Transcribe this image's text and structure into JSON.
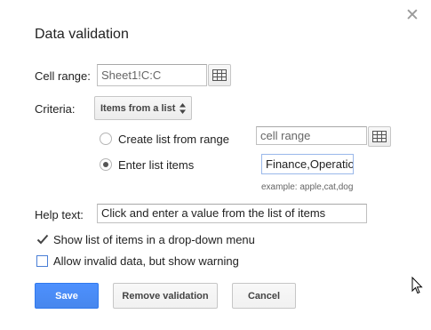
{
  "dialog": {
    "title": "Data validation",
    "close_icon": "close-icon"
  },
  "cell_range": {
    "label": "Cell range:",
    "value": "Sheet1!C:C"
  },
  "criteria": {
    "label": "Criteria:",
    "selected": "Items from a list",
    "options": {
      "from_range": {
        "label": "Create list from range",
        "placeholder": "cell range",
        "selected": false
      },
      "list_items": {
        "label": "Enter list items",
        "value": "Finance,Operatio",
        "hint": "example: apple,cat,dog",
        "selected": true
      }
    }
  },
  "help_text": {
    "label": "Help text:",
    "value": "Click and enter a value from the list of items"
  },
  "checkboxes": {
    "show_dropdown": {
      "label": "Show list of items in a drop-down menu",
      "checked": true
    },
    "allow_invalid": {
      "label": "Allow invalid data, but show warning",
      "checked": false
    }
  },
  "buttons": {
    "save": "Save",
    "remove": "Remove validation",
    "cancel": "Cancel"
  },
  "colors": {
    "primary": "#4d90fe",
    "close_grey": "#9a9a9a"
  }
}
